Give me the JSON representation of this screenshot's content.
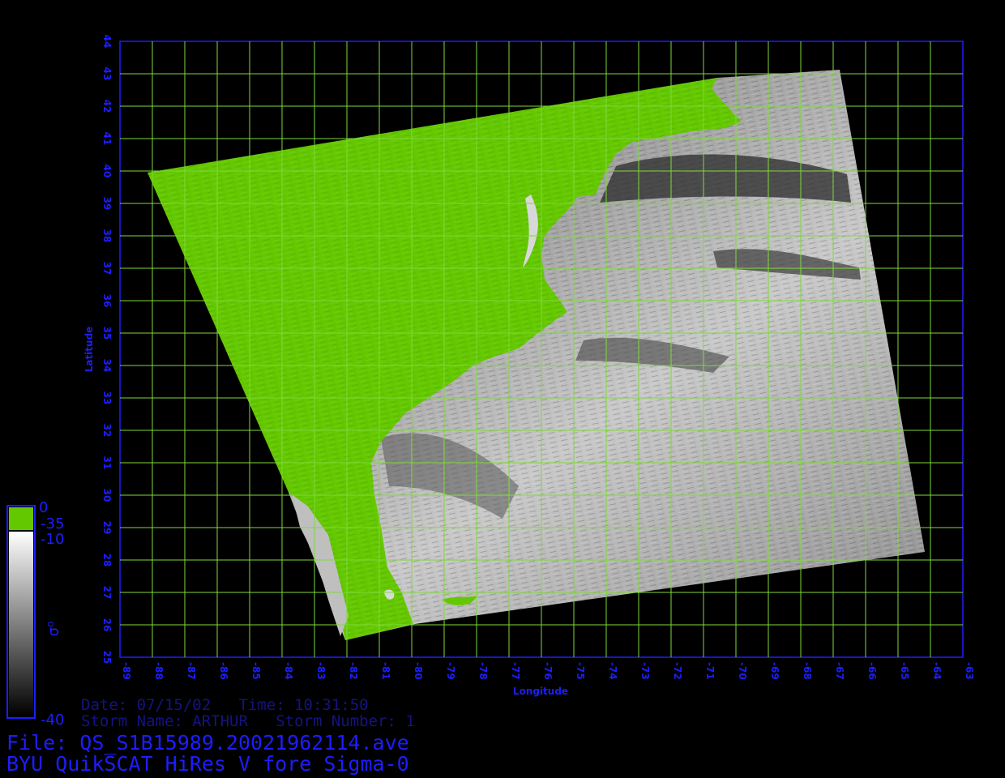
{
  "map": {
    "lon_range": [
      -89,
      -63
    ],
    "lat_range": [
      25,
      44
    ],
    "xlabel": "Longitude",
    "ylabel": "Latitude",
    "x_ticks": [
      "-89",
      "-88",
      "-87",
      "-86",
      "-85",
      "-84",
      "-83",
      "-82",
      "-81",
      "-80",
      "-79",
      "-78",
      "-77",
      "-76",
      "-75",
      "-74",
      "-73",
      "-72",
      "-71",
      "-70",
      "-69",
      "-68",
      "-67",
      "-66",
      "-65",
      "-64",
      "-63"
    ],
    "y_ticks": [
      "25",
      "26",
      "27",
      "28",
      "29",
      "30",
      "31",
      "32",
      "33",
      "34",
      "35",
      "36",
      "37",
      "38",
      "39",
      "40",
      "41",
      "42",
      "43",
      "44"
    ],
    "grid": true,
    "colors": {
      "land": "#64c800",
      "grid": "#7ed93a",
      "frame": "#1d1dff",
      "text": "#1d1dff",
      "background": "#000000"
    }
  },
  "colorbar": {
    "top_label": "0",
    "land_label": "-35",
    "upper_label": "-10",
    "bottom_label": "-40",
    "symbol": "σ⁰"
  },
  "info": {
    "date_line": "Date: 07/15/02   Time: 10:31:50",
    "storm_line": "Storm Name: ARTHUR   Storm Number: 1",
    "file_line": "File: QS_S1B15989.20021962114.ave",
    "product_line": "BYU QuikSCAT HiRes V fore Sigma-0"
  }
}
